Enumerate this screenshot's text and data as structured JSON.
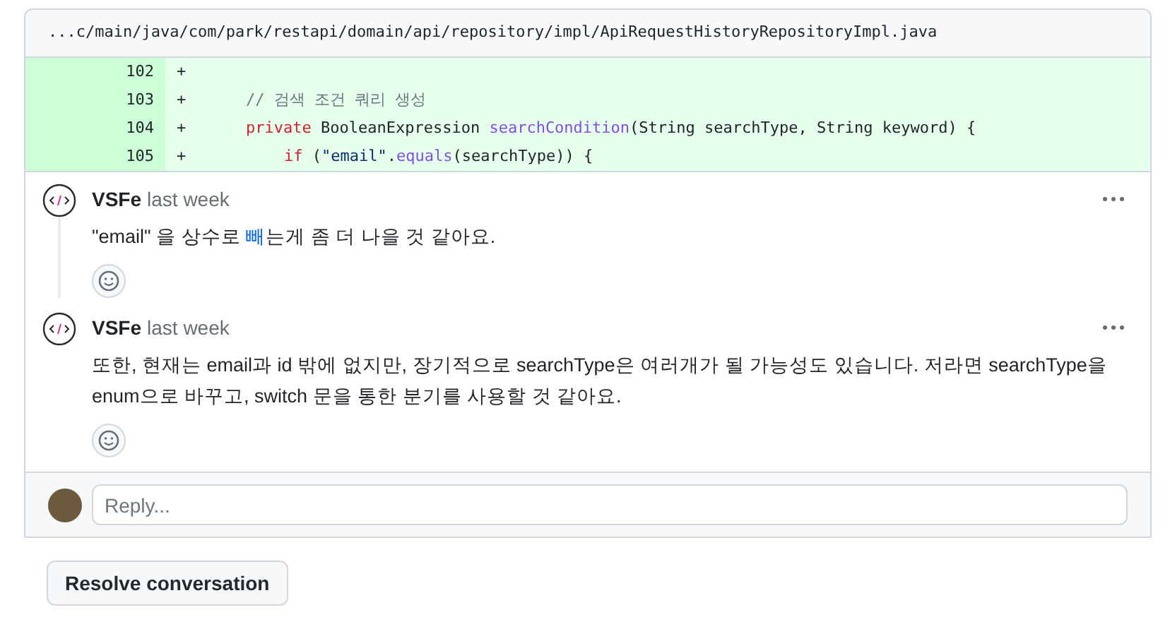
{
  "file_path": "...c/main/java/com/park/restapi/domain/api/repository/impl/ApiRequestHistoryRepositoryImpl.java",
  "code_lines": [
    {
      "number": "102",
      "marker": "+"
    },
    {
      "number": "103",
      "marker": "+",
      "kind": "member",
      "tokens": [
        {
          "kind": "comment",
          "text": "// 검색 조건 쿼리 생성"
        }
      ]
    },
    {
      "number": "104",
      "marker": "+",
      "kind": "member",
      "tokens": [
        {
          "kind": "keyword",
          "text": "private"
        },
        {
          "kind": "plain",
          "text": " BooleanExpression "
        },
        {
          "kind": "func",
          "text": "searchCondition"
        },
        {
          "kind": "plain",
          "text": "(String searchType, String keyword) {"
        }
      ]
    },
    {
      "number": "105",
      "marker": "+",
      "kind": "nested",
      "tokens": [
        {
          "kind": "keyword",
          "text": "if"
        },
        {
          "kind": "plain",
          "text": " ("
        },
        {
          "kind": "string",
          "text": "\"email\""
        },
        {
          "kind": "plain",
          "text": "."
        },
        {
          "kind": "func",
          "text": "equals"
        },
        {
          "kind": "plain",
          "text": "(searchType)) {"
        }
      ]
    }
  ],
  "comments": [
    {
      "author": "VSFe",
      "time": "last week",
      "body": [
        {
          "text": "\"email\" 을 상수로 ",
          "link": false
        },
        {
          "text": "빼",
          "link": true
        },
        {
          "text": "는게 좀 더 나을 것 같아요.",
          "link": false
        }
      ]
    },
    {
      "author": "VSFe",
      "time": "last week",
      "body": [
        {
          "text": "또한, 현재는 email과 id 밖에 없지만, 장기적으로 searchType은 여러개가 될 가능성도 있습니다. 저라면 searchType을 enum으로 바꾸고, switch 문을 통한 분기를 사용할 것 같아요.",
          "link": false
        }
      ]
    }
  ],
  "reply": {
    "placeholder": "Reply..."
  },
  "resolve_button": "Resolve conversation"
}
